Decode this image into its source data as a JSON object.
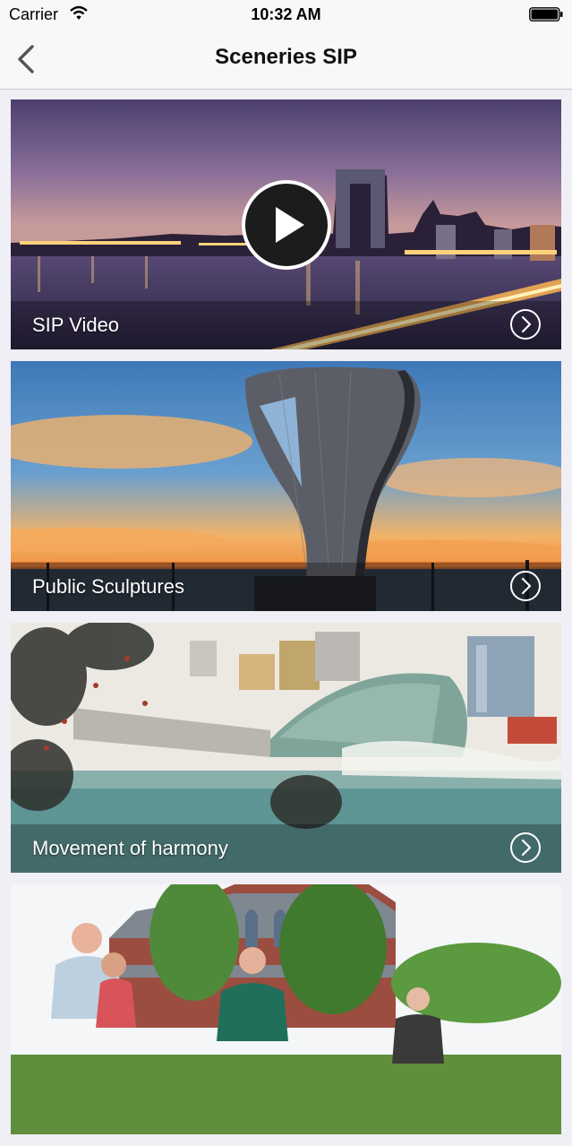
{
  "status_bar": {
    "carrier": "Carrier",
    "time": "10:32 AM"
  },
  "nav": {
    "title": "Sceneries SIP",
    "back_icon": "chevron-left-icon"
  },
  "items": [
    {
      "label": "SIP Video",
      "has_play": true,
      "theme": "night-city"
    },
    {
      "label": "Public Sculptures",
      "has_play": false,
      "theme": "sunset-sculpture"
    },
    {
      "label": "Movement of harmony",
      "has_play": false,
      "theme": "ink-painting"
    },
    {
      "label": "",
      "has_play": false,
      "theme": "garden-people"
    }
  ],
  "colors": {
    "nav_bg": "#f8f8f8",
    "page_bg": "#f0eff5",
    "accent": "#111111"
  }
}
